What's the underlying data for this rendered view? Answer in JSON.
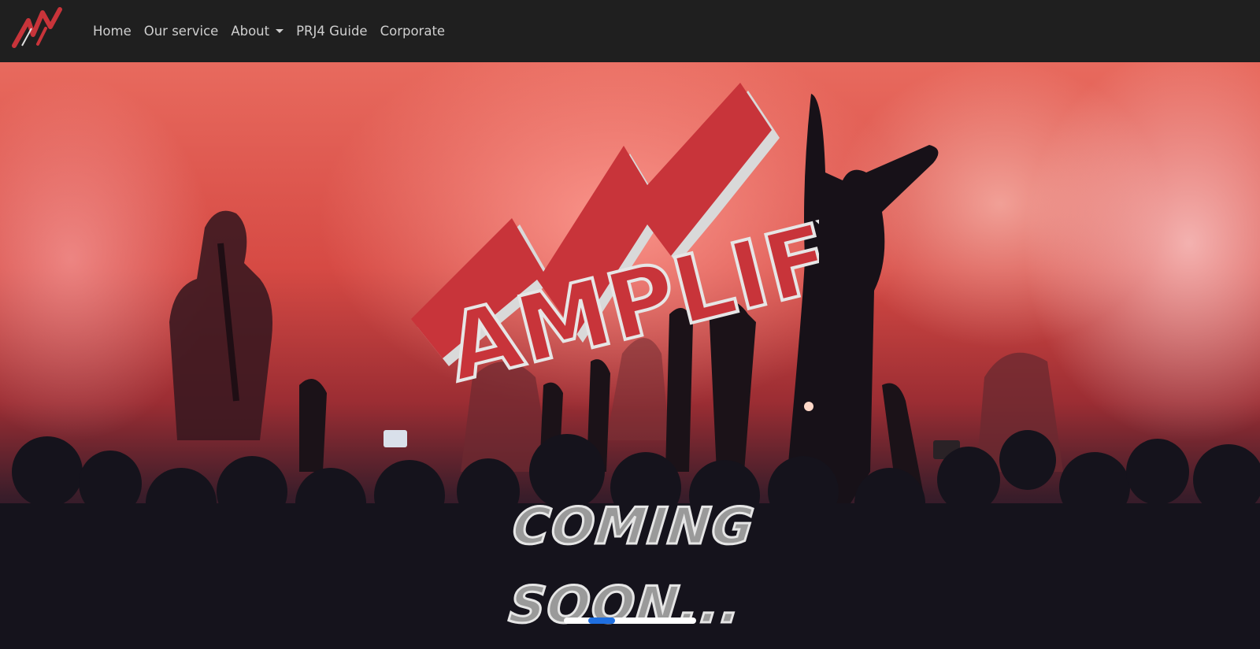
{
  "nav": {
    "brand": "Amplify logo",
    "links": [
      "Home",
      "Our service",
      "About",
      "PRJ4 Guide",
      "Corporate"
    ]
  },
  "hero": {
    "logo_text": "AMPLIFY",
    "subtitle": "COMING SOON..."
  },
  "carousel": {
    "slides": 5,
    "active_index": 1
  },
  "colors": {
    "navbar_bg": "#1f1f1f",
    "nav_link": "#cfcfcf",
    "logo_red": "#c8343a",
    "indicator_active": "#1f6fe0"
  },
  "icons": {
    "brand": "amplify-logo-icon",
    "dropdown": "chevron-down-icon"
  }
}
